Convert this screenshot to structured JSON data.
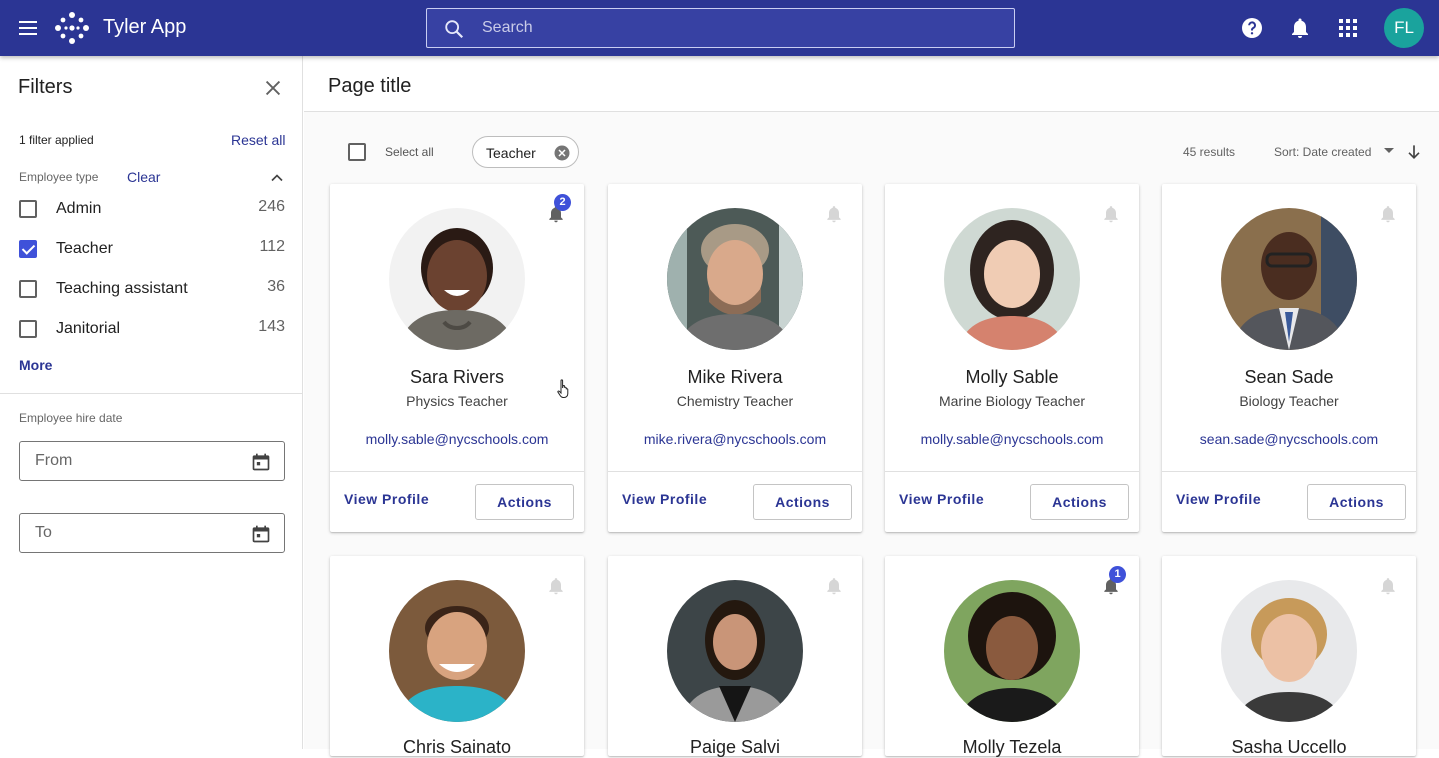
{
  "app": {
    "title": "Tyler App",
    "search_placeholder": "Search",
    "avatar_initials": "FL",
    "bar_color": "#2b3594",
    "avatar_color": "#1aa39d",
    "icons": [
      "menu-icon",
      "logo-icon",
      "search-icon",
      "help-icon",
      "bell-icon",
      "apps-grid-icon"
    ]
  },
  "filters": {
    "title": "Filters",
    "applied": "1 filter applied",
    "reset": "Reset all",
    "employee_type": {
      "label": "Employee type",
      "clear": "Clear",
      "options": [
        {
          "label": "Admin",
          "count": "246",
          "checked": false
        },
        {
          "label": "Teacher",
          "count": "112",
          "checked": true
        },
        {
          "label": "Teaching assistant",
          "count": "36",
          "checked": false
        },
        {
          "label": "Janitorial",
          "count": "143",
          "checked": false
        }
      ],
      "more": "More"
    },
    "hire_date": {
      "label": "Employee hire date",
      "from_placeholder": "From",
      "to_placeholder": "To"
    }
  },
  "main": {
    "page_title": "Page title",
    "select_all": "Select all",
    "chip": "Teacher",
    "results": "45 results",
    "sort": "Sort: Date created"
  },
  "cards": [
    {
      "name": "Sara Rivers",
      "role": "Physics Teacher",
      "email": "molly.sable@nycschools.com",
      "notifications": "2"
    },
    {
      "name": "Mike Rivera",
      "role": "Chemistry Teacher",
      "email": "mike.rivera@nycschools.com",
      "notifications": ""
    },
    {
      "name": "Molly Sable",
      "role": "Marine Biology Teacher",
      "email": "molly.sable@nycschools.com",
      "notifications": ""
    },
    {
      "name": "Sean Sade",
      "role": "Biology Teacher",
      "email": "sean.sade@nycschools.com",
      "notifications": ""
    },
    {
      "name": "Chris Sainato",
      "notifications": ""
    },
    {
      "name": "Paige Salvi",
      "notifications": ""
    },
    {
      "name": "Molly Tezela",
      "notifications": "1"
    },
    {
      "name": "Sasha Uccello",
      "notifications": ""
    }
  ],
  "card_actions": {
    "view_profile": "View Profile",
    "actions": "Actions"
  }
}
